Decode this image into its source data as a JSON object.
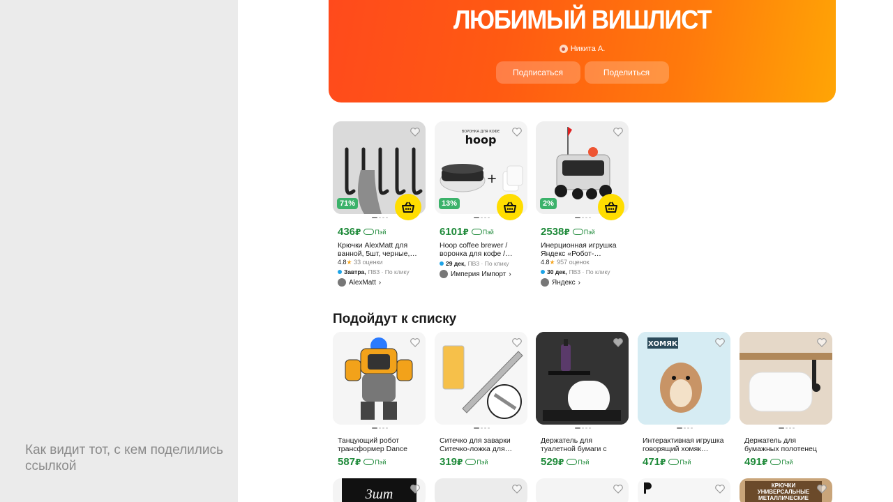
{
  "caption": "Как видит тот, с кем поделились ссылкой",
  "banner": {
    "title": "ЛЮБИМЫЙ ВИШЛИСТ",
    "author": "Никита А.",
    "subscribe_label": "Подписаться",
    "share_label": "Поделиться"
  },
  "wishlist": [
    {
      "price": "436",
      "currency": "₽",
      "pay_label": "Пэй",
      "discount": "71%",
      "name": "Крючки AlexMatt для ванной, 5шт, черные,…",
      "rating": "4.8",
      "reviews": "33 оценки",
      "delivery_date": "Завтра,",
      "delivery_rest": "ПВЗ · По клику",
      "shop": "AlexMatt",
      "image": "hooks"
    },
    {
      "price": "6101",
      "currency": "₽",
      "pay_label": "Пэй",
      "discount": "13%",
      "name": "Hoop coffee brewer / воронка для кофе /…",
      "rating": "",
      "reviews": "",
      "delivery_date": "29 дек,",
      "delivery_rest": "ПВЗ · По клику",
      "shop": "Империя Импорт",
      "image": "hoop"
    },
    {
      "price": "2538",
      "currency": "₽",
      "pay_label": "Пэй",
      "discount": "2%",
      "name": "Инерционная игрушка Яндекс «Робот-…",
      "rating": "4.8",
      "reviews": "957 оценок",
      "delivery_date": "30 дек,",
      "delivery_rest": "ПВЗ · По клику",
      "shop": "Яндекс",
      "image": "robot"
    }
  ],
  "recommendations_title": "Подойдут к списку",
  "recommendations": [
    {
      "price": "587",
      "currency": "₽",
      "pay_label": "Пэй",
      "name": "Танцующий робот трансформер Dance Her…",
      "image": "bumblebee"
    },
    {
      "price": "319",
      "currency": "₽",
      "pay_label": "Пэй",
      "name": "Ситечко для заварки Ситечко-ложка для…",
      "image": "strainer"
    },
    {
      "price": "529",
      "currency": "₽",
      "pay_label": "Пэй",
      "name": "Держатель для туалетной бумаги с полочкой для…",
      "image": "toilet"
    },
    {
      "price": "471",
      "currency": "₽",
      "pay_label": "Пэй",
      "name": "Интерактивная игрушка говорящий хомяк…",
      "image": "hamster",
      "img_text": "ХОМЯК"
    },
    {
      "price": "491",
      "currency": "₽",
      "pay_label": "Пэй",
      "name": "Держатель для бумажных полотенец",
      "image": "towel"
    }
  ],
  "bottom_row_texts": [
    "3шт",
    "КРЮЧКИ УНИВЕРСАЛЬНЫЕ МЕТАЛЛИЧЕСКИЕ"
  ],
  "colors": {
    "price_green": "#1f8a3a",
    "cart_yellow": "#ffdd00",
    "discount_green": "#3bb26a",
    "banner_start": "#ff4a1c",
    "banner_end": "#ffa505"
  }
}
